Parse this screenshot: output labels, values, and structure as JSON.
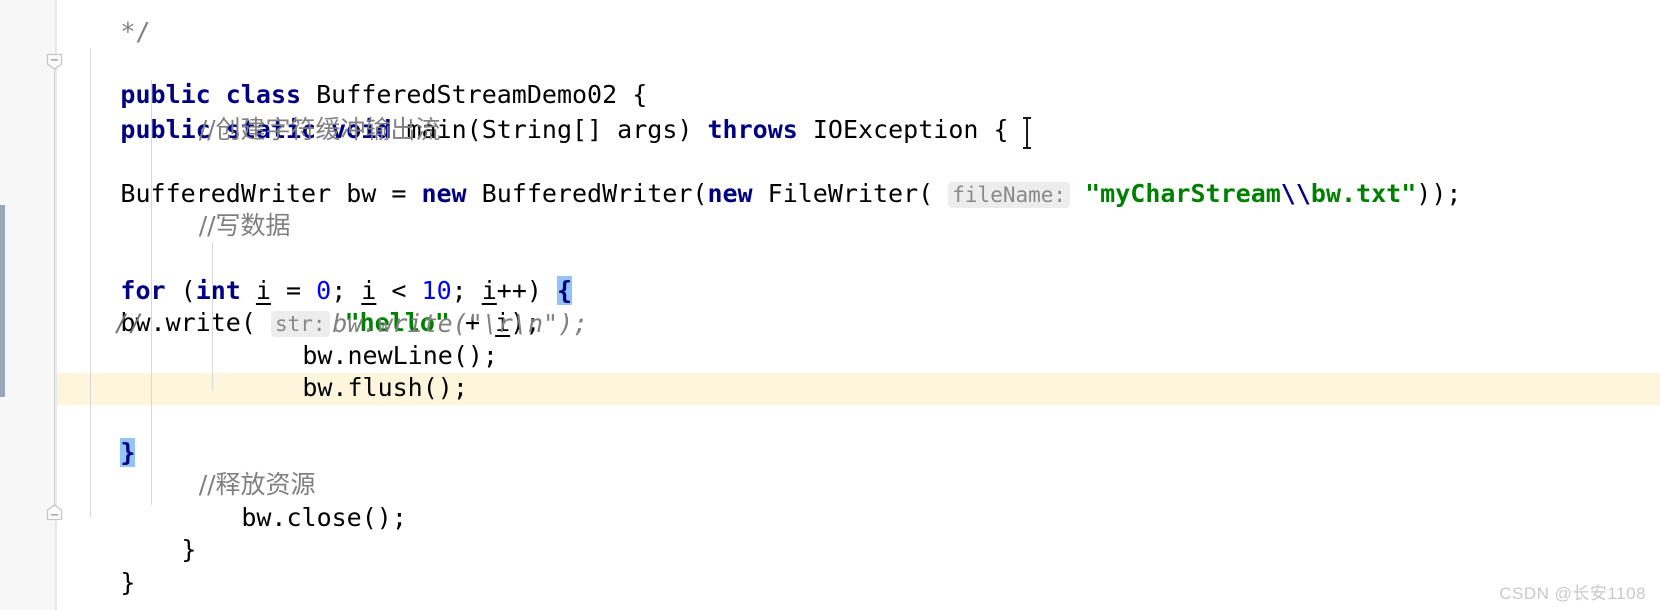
{
  "editor": {
    "app": "IntelliJ IDEA code editor",
    "language": "Java",
    "file_class": "BufferedStreamDemo02",
    "theme_colors": {
      "background": "#ffffff",
      "gutter": "#f7f7f7",
      "keyword": "#000080",
      "string": "#008000",
      "number": "#0000ff",
      "comment": "#808080",
      "hint_text": "#8a8a8a",
      "hint_background": "#ededed",
      "current_line": "#fdf6dd",
      "brace_match": "#93c4f5",
      "vcs_changed": "#9aa7b8"
    },
    "lines": {
      "l0_comment_end": "*/",
      "l1_a": "public",
      "l1_b": "class",
      "l1_c": "BufferedStreamDemo02 {",
      "l2_a": "public",
      "l2_b": "static",
      "l2_c": "void",
      "l2_d": "main(String[] args)",
      "l2_e": "throws",
      "l2_f": "IOException {",
      "l3_comment": "//创建字符缓冲输出流",
      "l4_a": "BufferedWriter bw = ",
      "l4_b": "new",
      "l4_c": " BufferedWriter(",
      "l4_d": "new",
      "l4_e": " FileWriter( ",
      "l4_hint": "fileName:",
      "l4_str_open": "\"myCharStream",
      "l4_str_esc": "\\\\",
      "l4_str_close": "bw.txt\"",
      "l4_tail": "));",
      "l6_comment": "//写数据",
      "l7_a": "for",
      "l7_b": " (",
      "l7_c": "int",
      "l7_d": "i",
      "l7_e": " = ",
      "l7_f": "0",
      "l7_g": "; ",
      "l7_h": "i",
      "l7_i": " < ",
      "l7_j": "10",
      "l7_k": "; ",
      "l7_l": "i",
      "l7_m": "++) ",
      "l7_brace": "{",
      "l8_a": "bw.write( ",
      "l8_hint": "str:",
      "l8_str": "\"hello\"",
      "l8_b": " + ",
      "l8_c": "i",
      "l8_d": ");",
      "l9_gutter_comment": "//",
      "l9_code": "bw.write(\"\\r\\n\");",
      "l10": "bw.newLine();",
      "l11": "bw.flush();",
      "l12_brace": "}",
      "l14_comment": "//释放资源",
      "l15": "bw.close();",
      "l16_brace": "}",
      "l17_brace": "}"
    },
    "gutter": {
      "fold_icon_top": "fold-collapse-icon",
      "fold_icon_bottom": "fold-collapse-end-icon"
    }
  },
  "watermark": {
    "text": "CSDN @长安1108"
  }
}
